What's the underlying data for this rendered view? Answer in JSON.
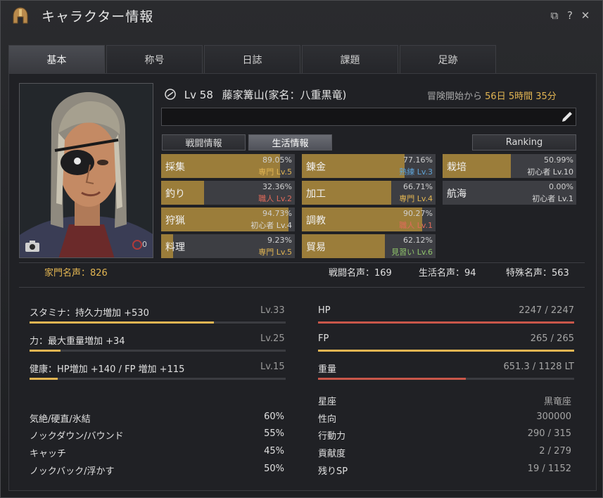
{
  "window": {
    "title": "キャラクター情報"
  },
  "titlebar_buttons": {
    "minimize": "⧉",
    "help": "?",
    "close": "✕"
  },
  "tabs": [
    "基本",
    "称号",
    "日誌",
    "課題",
    "足跡"
  ],
  "character": {
    "level_text": "Lv 58",
    "name_text": "藤家篝山(家名：八重黒竜)",
    "badge_count": "0"
  },
  "adventure": {
    "prefix": "冒険開始から",
    "value": "56日 5時間 35分"
  },
  "subtabs": {
    "combat": "戦闘情報",
    "life": "生活情報",
    "ranking": "Ranking"
  },
  "life_skills": [
    {
      "name": "採集",
      "pct": "89.05%",
      "rank": "専門 Lv.5",
      "fill": 0.89,
      "rank_color": "#e2b552"
    },
    {
      "name": "釣り",
      "pct": "32.36%",
      "rank": "職人 Lv.2",
      "fill": 0.32,
      "rank_color": "#e06a5a"
    },
    {
      "name": "狩猟",
      "pct": "94.73%",
      "rank": "初心者 Lv.4",
      "fill": 0.95,
      "rank_color": "#d8d8d8"
    },
    {
      "name": "料理",
      "pct": "9.23%",
      "rank": "専門 Lv.5",
      "fill": 0.09,
      "rank_color": "#e2b552"
    },
    {
      "name": "錬金",
      "pct": "77.16%",
      "rank": "熟練 Lv.3",
      "fill": 0.77,
      "rank_color": "#5fa3d6"
    },
    {
      "name": "加工",
      "pct": "66.71%",
      "rank": "専門 Lv.4",
      "fill": 0.67,
      "rank_color": "#e2b552"
    },
    {
      "name": "調教",
      "pct": "90.27%",
      "rank": "職人 Lv.1",
      "fill": 0.9,
      "rank_color": "#e06a5a"
    },
    {
      "name": "貿易",
      "pct": "62.12%",
      "rank": "見習い Lv.6",
      "fill": 0.62,
      "rank_color": "#8fc56a"
    },
    {
      "name": "栽培",
      "pct": "50.99%",
      "rank": "初心者 Lv.10",
      "fill": 0.51,
      "rank_color": "#d8d8d8"
    },
    {
      "name": "航海",
      "pct": "0.00%",
      "rank": "初心者 Lv.1",
      "fill": 0.0,
      "rank_color": "#d8d8d8"
    }
  ],
  "fame": {
    "family": "家門名声：826",
    "combat": "戦闘名声：169",
    "life": "生活名声：94",
    "special": "特殊名声：563"
  },
  "stats": [
    {
      "label": "スタミナ：持久力増加 +530",
      "lv": "Lv.33",
      "fill": 0.72
    },
    {
      "label": "力：最大重量増加 +34",
      "lv": "Lv.25",
      "fill": 0.12
    },
    {
      "label": "健康：HP増加 +140 / FP 増加 +115",
      "lv": "Lv.15",
      "fill": 0.11
    }
  ],
  "resources": [
    {
      "label": "HP",
      "value": "2247 / 2247",
      "fill": 1.0,
      "color": "#c9574a"
    },
    {
      "label": "FP",
      "value": "265 / 265",
      "fill": 1.0,
      "color": "#e2b552"
    },
    {
      "label": "重量",
      "value": "651.3 / 1128 LT",
      "fill": 0.577,
      "color": "#c9574a"
    }
  ],
  "resists": [
    {
      "label": "気絶/硬直/氷結",
      "value": "60%"
    },
    {
      "label": "ノックダウン/バウンド",
      "value": "55%"
    },
    {
      "label": "キャッチ",
      "value": "45%"
    },
    {
      "label": "ノックバック/浮かす",
      "value": "50%"
    }
  ],
  "info": [
    {
      "label": "星座",
      "value": "黒竜座"
    },
    {
      "label": "性向",
      "value": "300000"
    },
    {
      "label": "行動力",
      "value": "290 / 315"
    },
    {
      "label": "貢献度",
      "value": "2 / 279"
    },
    {
      "label": "残りSP",
      "value": "19 / 1152"
    }
  ],
  "colors": {
    "accent_gold": "#e2b552",
    "bar_gold": "#9b7d3a",
    "hp_red": "#c9574a"
  },
  "icons": {
    "logo": "helmet-icon",
    "edit": "pencil-icon",
    "screenshot": "camera-icon",
    "adventure": "clock-icon"
  }
}
